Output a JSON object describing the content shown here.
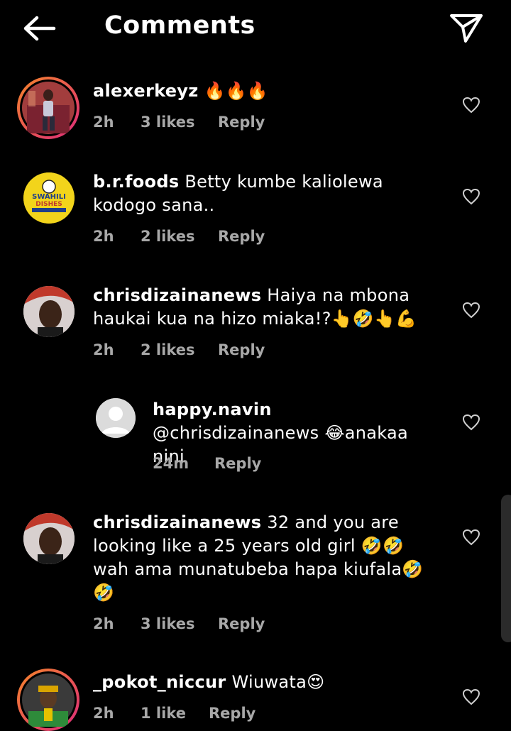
{
  "header": {
    "title": "Comments",
    "back_icon": "arrow-left-icon",
    "send_icon": "paper-plane-icon"
  },
  "comments": [
    {
      "username": "alexerkeyz",
      "text": "🔥🔥🔥",
      "time": "2h",
      "likes": "3 likes",
      "reply": "Reply"
    },
    {
      "username": "b.r.foods",
      "text": "Betty kumbe kaliolewa kodogo sana..",
      "time": "2h",
      "likes": "2 likes",
      "reply": "Reply",
      "avatar_text_1": "SWAHILI",
      "avatar_text_2": "DISHES"
    },
    {
      "username": "chrisdizainanews",
      "text": "Haiya na mbona haukai kua na hizo miaka!?👆🤣👆💪",
      "time": "2h",
      "likes": "2 likes",
      "reply": "Reply"
    },
    {
      "username": "happy.navin",
      "text": "@chrisdizainanews 😂anakaa nini",
      "time": "24m",
      "reply": "Reply"
    },
    {
      "username": "chrisdizainanews",
      "text": "32 and you are looking like a 25 years old girl 🤣🤣 wah ama munatubeba hapa kiufala🤣🤣",
      "time": "2h",
      "likes": "3 likes",
      "reply": "Reply"
    },
    {
      "username": "_pokot_niccur",
      "text": "Wiuwata😍",
      "time": "2h",
      "likes": "1 like",
      "reply": "Reply"
    }
  ],
  "colors": {
    "background": "#000000",
    "text": "#ffffff",
    "meta": "#a8a8a8",
    "story_ring_start": "#f58529",
    "story_ring_end": "#dd2a7b"
  }
}
